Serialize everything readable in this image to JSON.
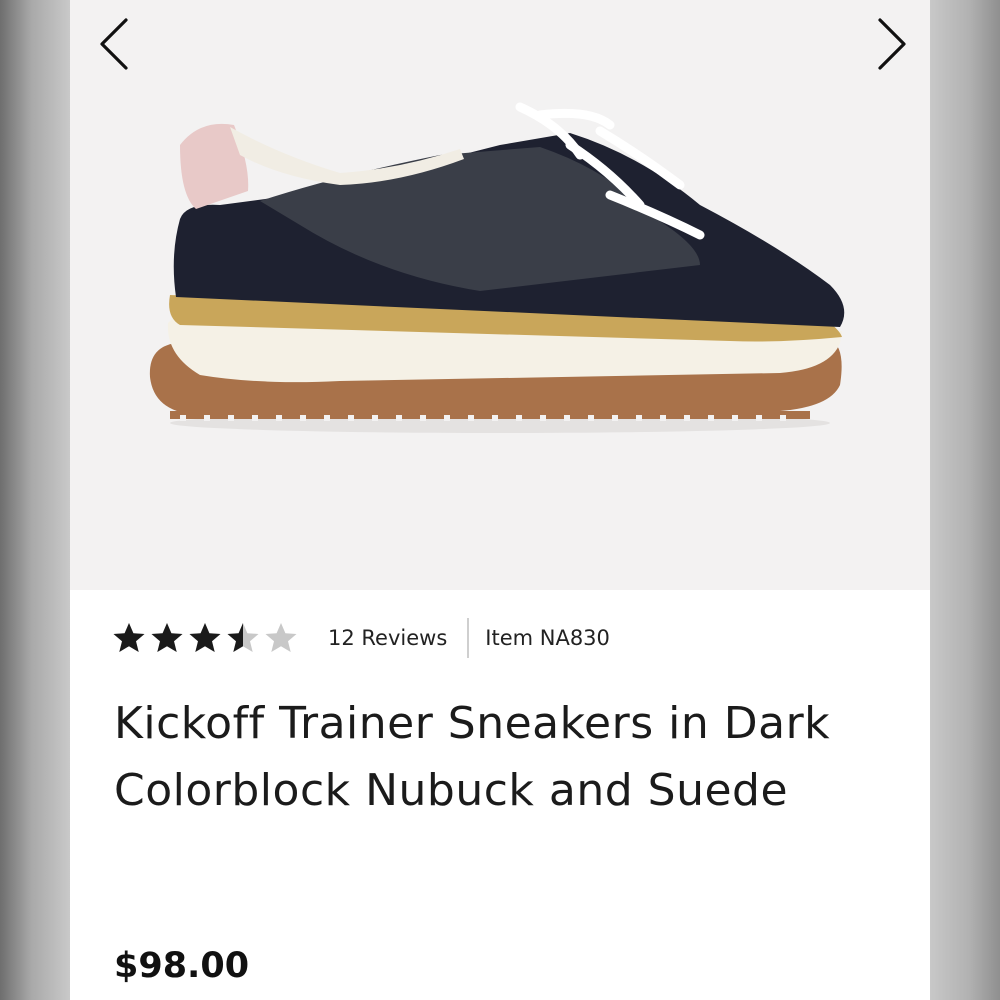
{
  "gallery": {
    "prev_icon": "chevron-left-icon",
    "next_icon": "chevron-right-icon",
    "image": "sneaker-product-photo"
  },
  "product": {
    "rating": 3.5,
    "rating_max": 5,
    "reviews_label": "12 Reviews",
    "item_label": "Item NA830",
    "title": "Kickoff Trainer Sneakers in Dark Colorblock Nubuck and Suede",
    "price": "$98.00"
  },
  "colors": {
    "star_filled": "#1a1a1a",
    "star_empty": "#c8c8c8",
    "upper": "#2b2f3a",
    "stripe": "#c9a65a",
    "midsole": "#f5f1e6",
    "outsole": "#a9724a",
    "heel": "#e8c9c8"
  }
}
